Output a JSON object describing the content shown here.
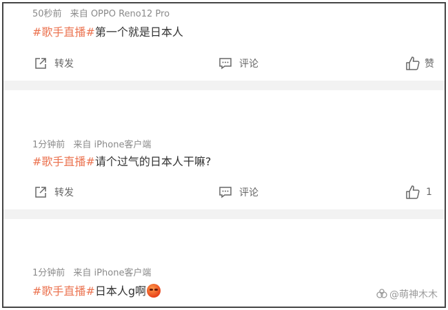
{
  "posts": [
    {
      "time": "50秒前",
      "source": "来自 OPPO Reno12 Pro",
      "hashtag": "#歌手直播#",
      "text": "第一个就是日本人",
      "repost_label": "转发",
      "comment_label": "评论",
      "like_label": "赞"
    },
    {
      "time": "1分钟前",
      "source": "来自 iPhone客户端",
      "hashtag": "#歌手直播#",
      "text": "请个过气的日本人干嘛?",
      "repost_label": "转发",
      "comment_label": "评论",
      "like_label": "1"
    },
    {
      "time": "1分钟前",
      "source": "来自 iPhone客户端",
      "hashtag": "#歌手直播#",
      "text": "日本人g啊",
      "emoji": "angry-face-emoji"
    }
  ],
  "watermark": {
    "text": "@萌神木木",
    "icon": "watermark-logo-icon"
  },
  "colors": {
    "hashtag": "#eb7350",
    "meta": "#8a8a8a",
    "separator": "#f2f2f2",
    "text": "#333333"
  }
}
